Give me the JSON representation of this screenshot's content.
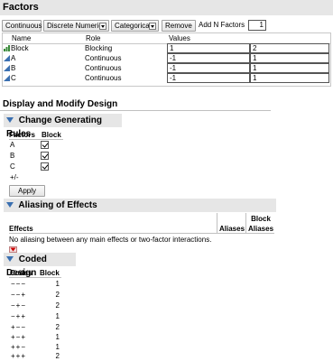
{
  "factors": {
    "title": "Factors",
    "buttons": {
      "continuous": "Continuous",
      "discrete_numeric": "Discrete Numeric",
      "categorical": "Categorical",
      "remove": "Remove",
      "add_n_label": "Add N Factors",
      "add_n_value": "1"
    },
    "columns": {
      "name": "Name",
      "role": "Role",
      "values": "Values"
    },
    "rows": [
      {
        "name": "Block",
        "role": "Blocking",
        "v1": "1",
        "v2": "2"
      },
      {
        "name": "A",
        "role": "Continuous",
        "v1": "-1",
        "v2": "1"
      },
      {
        "name": "B",
        "role": "Continuous",
        "v1": "-1",
        "v2": "1"
      },
      {
        "name": "C",
        "role": "Continuous",
        "v1": "-1",
        "v2": "1"
      }
    ]
  },
  "display": {
    "title": "Display and Modify Design"
  },
  "gen_rules": {
    "title": "Change Generating Rules",
    "col_factors": "Factors",
    "col_block": "Block",
    "rows": [
      "A",
      "B",
      "C"
    ],
    "plusminus": "+/-",
    "apply": "Apply"
  },
  "aliasing": {
    "title": "Aliasing of Effects",
    "col_effects": "Effects",
    "col_aliases": "Aliases",
    "col_block_aliases_1": "Block",
    "col_block_aliases_2": "Aliases",
    "message": "No aliasing between any main effects or two-factor interactions."
  },
  "coded": {
    "title": "Coded Design",
    "col_codes": "Codes",
    "col_block": "Block",
    "rows": [
      {
        "code": "−−−",
        "block": "1"
      },
      {
        "code": "−−+",
        "block": "2"
      },
      {
        "code": "−+−",
        "block": "2"
      },
      {
        "code": "−++",
        "block": "1"
      },
      {
        "code": "+−−",
        "block": "2"
      },
      {
        "code": "+−+",
        "block": "1"
      },
      {
        "code": "++−",
        "block": "1"
      },
      {
        "code": "+++",
        "block": "2"
      }
    ]
  },
  "colors": {
    "section_bg": "#e6e6e6",
    "triangle": "#3a6fb0",
    "red_triangle": "#cc0000"
  },
  "icons": [
    "disclosure-triangle-icon",
    "blocking-factor-icon",
    "continuous-factor-icon",
    "red-triangle-menu-icon",
    "checkmark-icon"
  ]
}
